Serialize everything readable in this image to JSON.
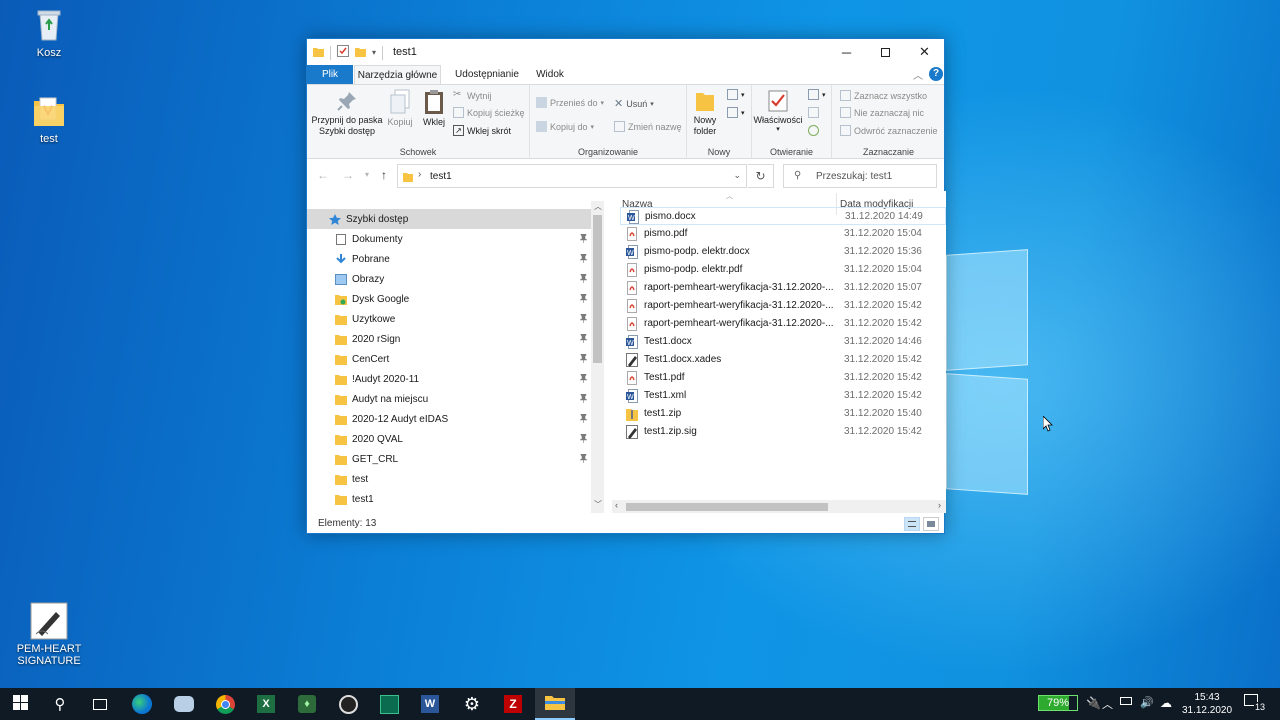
{
  "desktop": {
    "icons": [
      {
        "label": "Kosz"
      },
      {
        "label": "test"
      },
      {
        "label": "PEM-HEART SIGNATURE"
      }
    ]
  },
  "window": {
    "title": "test1",
    "tabs": [
      {
        "label": "Plik"
      },
      {
        "label": "Narzędzia główne"
      },
      {
        "label": "Udostępnianie"
      },
      {
        "label": "Widok"
      }
    ],
    "ribbon": {
      "clipboard": {
        "pin_label": "Przypnij do paska Szybki dostęp",
        "copy_label": "Kopiuj",
        "paste_label": "Wklej",
        "cut_label": "Wytnij",
        "copy_path_label": "Kopiuj ścieżkę",
        "paste_shortcut_label": "Wklej skrót",
        "group_label": "Schowek"
      },
      "organize": {
        "move_to_label": "Przenieś do",
        "copy_to_label": "Kopiuj do",
        "delete_label": "Usuń",
        "rename_label": "Zmień nazwę",
        "group_label": "Organizowanie"
      },
      "new": {
        "new_folder_label": "Nowy folder",
        "group_label": "Nowy"
      },
      "open": {
        "properties_label": "Właściwości",
        "group_label": "Otwieranie"
      },
      "select": {
        "select_all_label": "Zaznacz wszystko",
        "select_none_label": "Nie zaznaczaj nic",
        "invert_label": "Odwróć zaznaczenie",
        "group_label": "Zaznaczanie"
      }
    },
    "address": {
      "path": "test1",
      "search_placeholder": "Przeszukaj: test1"
    },
    "nav": {
      "items": [
        {
          "label": "Szybki dostęp",
          "pinned": false
        },
        {
          "label": "Dokumenty",
          "pinned": true
        },
        {
          "label": "Pobrane",
          "pinned": true
        },
        {
          "label": "Obrazy",
          "pinned": true
        },
        {
          "label": "Dysk Google",
          "pinned": true
        },
        {
          "label": "Uzytkowe",
          "pinned": true
        },
        {
          "label": "2020 rSign",
          "pinned": true
        },
        {
          "label": "CenCert",
          "pinned": true
        },
        {
          "label": "!Audyt 2020-11",
          "pinned": true
        },
        {
          "label": "Audyt na miejscu",
          "pinned": true
        },
        {
          "label": "2020-12 Audyt eIDAS",
          "pinned": true
        },
        {
          "label": "2020 QVAL",
          "pinned": true
        },
        {
          "label": "GET_CRL",
          "pinned": true
        },
        {
          "label": "test",
          "pinned": false
        },
        {
          "label": "test1",
          "pinned": false
        }
      ]
    },
    "files": {
      "col_name": "Nazwa",
      "col_date": "Data modyfikacji",
      "rows": [
        {
          "name": "pismo.docx",
          "date": "31.12.2020 14:49",
          "type": "word"
        },
        {
          "name": "pismo.pdf",
          "date": "31.12.2020 15:04",
          "type": "pdf"
        },
        {
          "name": "pismo-podp. elektr.docx",
          "date": "31.12.2020 15:36",
          "type": "word"
        },
        {
          "name": "pismo-podp. elektr.pdf",
          "date": "31.12.2020 15:04",
          "type": "pdf"
        },
        {
          "name": "raport-pemheart-weryfikacja-31.12.2020-...",
          "date": "31.12.2020 15:07",
          "type": "pdf"
        },
        {
          "name": "raport-pemheart-weryfikacja-31.12.2020-...",
          "date": "31.12.2020 15:42",
          "type": "pdf"
        },
        {
          "name": "raport-pemheart-weryfikacja-31.12.2020-...",
          "date": "31.12.2020 15:42",
          "type": "pdf"
        },
        {
          "name": "Test1.docx",
          "date": "31.12.2020 14:46",
          "type": "word"
        },
        {
          "name": "Test1.docx.xades",
          "date": "31.12.2020 15:42",
          "type": "sig"
        },
        {
          "name": "Test1.pdf",
          "date": "31.12.2020 15:42",
          "type": "pdf"
        },
        {
          "name": "Test1.xml",
          "date": "31.12.2020 15:42",
          "type": "word"
        },
        {
          "name": "test1.zip",
          "date": "31.12.2020 15:40",
          "type": "zip"
        },
        {
          "name": "test1.zip.sig",
          "date": "31.12.2020 15:42",
          "type": "sig"
        }
      ]
    },
    "status": {
      "count_text": "Elementy: 13"
    }
  },
  "taskbar": {
    "battery": "79%",
    "time": "15:43",
    "date": "31.12.2020",
    "notifications": "13"
  },
  "colors": {
    "accent": "#1979ca",
    "pdf": "#d83b2b",
    "word": "#2b579a",
    "folder": "#f6c343"
  }
}
